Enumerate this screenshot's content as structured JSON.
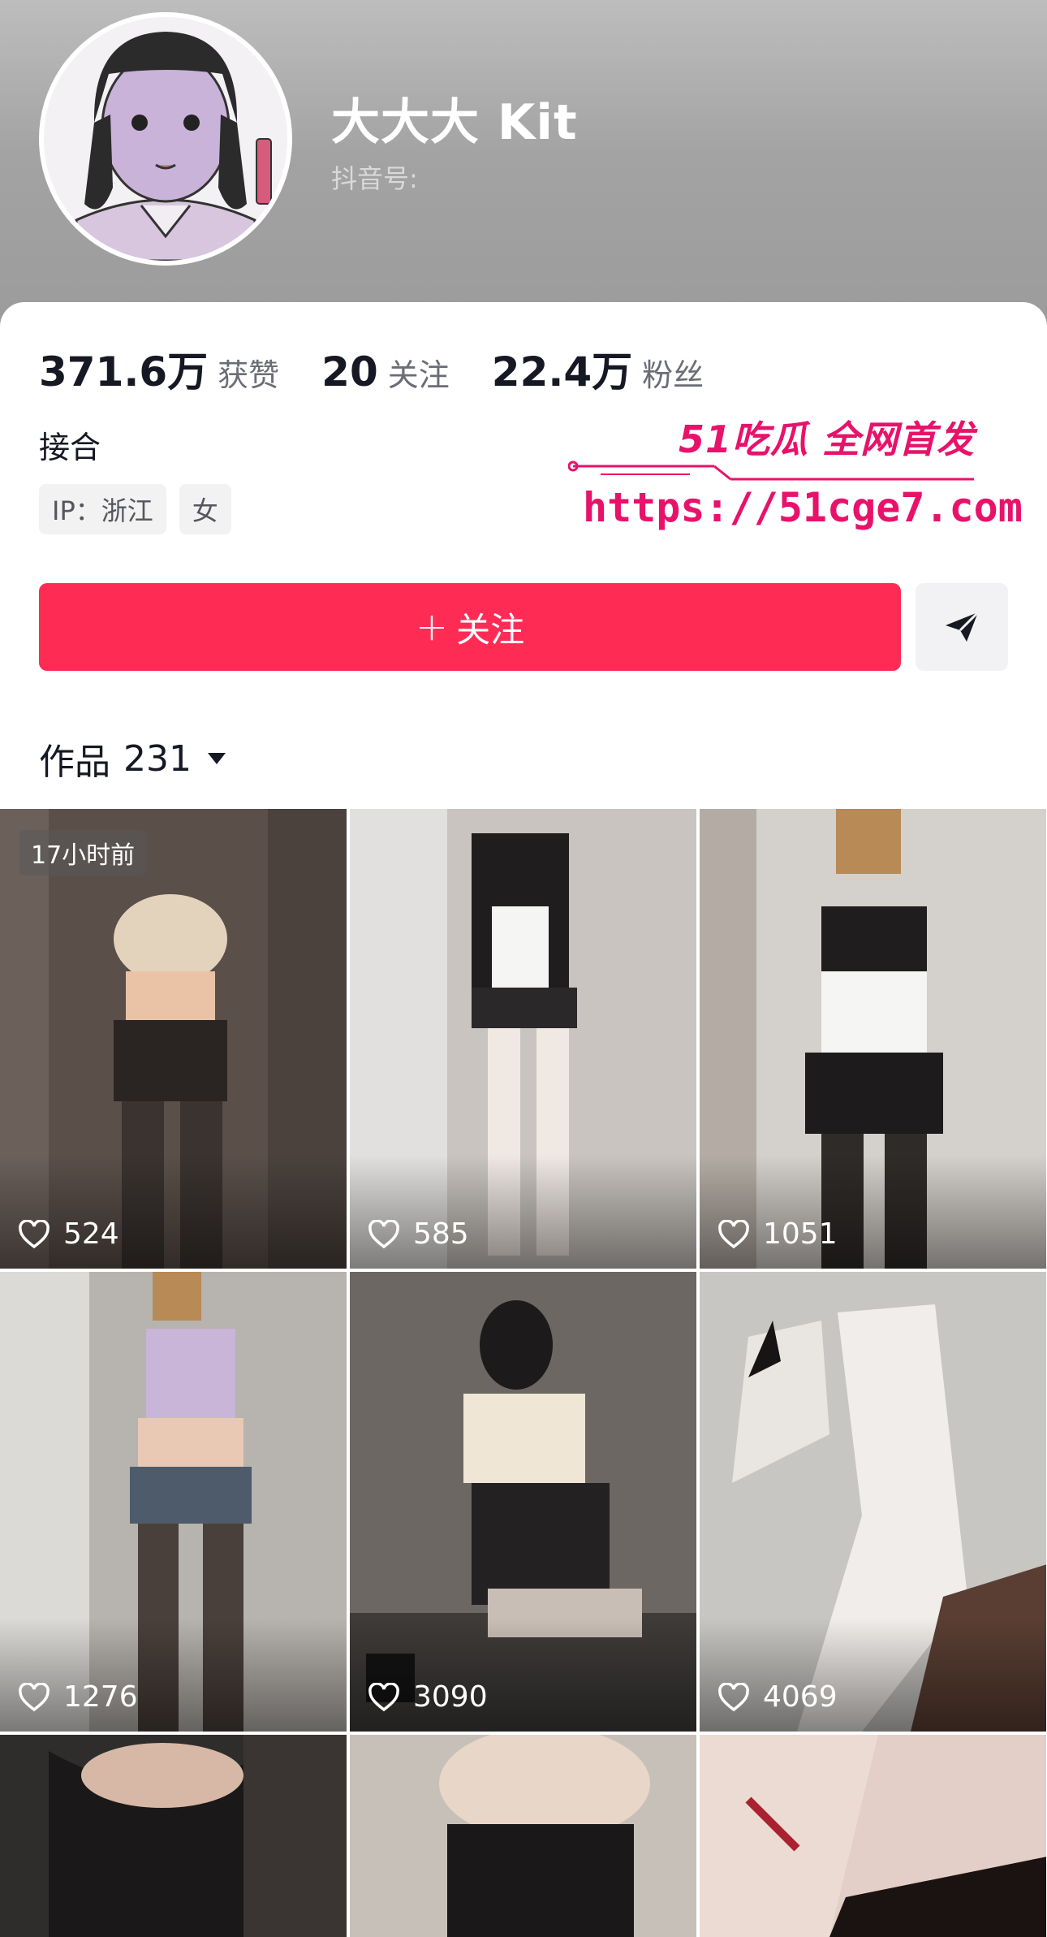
{
  "profile": {
    "nickname": "大大大 Kit",
    "douyin_id_label": "抖音号:",
    "bio": "接合",
    "tags": [
      "IP：浙江",
      "女"
    ]
  },
  "stats": [
    {
      "value": "371.6万",
      "label": "获赞"
    },
    {
      "value": "20",
      "label": "关注"
    },
    {
      "value": "22.4万",
      "label": "粉丝"
    }
  ],
  "watermark": {
    "brand": "51吃瓜 全网首发",
    "url": "https://51cge7.com"
  },
  "actions": {
    "follow_plus": "+",
    "follow_label": "关注",
    "share_icon": "send-icon"
  },
  "works": {
    "label": "作品",
    "count": "231"
  },
  "videos": [
    {
      "likes": "524",
      "badge": "17小时前",
      "bg": "#5a4f49"
    },
    {
      "likes": "585",
      "badge": "",
      "bg": "#c9c4bf"
    },
    {
      "likes": "1051",
      "badge": "",
      "bg": "#d4d0cb"
    },
    {
      "likes": "1276",
      "badge": "",
      "bg": "#b7b3ae"
    },
    {
      "likes": "3090",
      "badge": "",
      "bg": "#6c6763"
    },
    {
      "likes": "4069",
      "badge": "",
      "bg": "#c8c6c3"
    },
    {
      "likes": "",
      "badge": "",
      "bg": "#2f2d2c"
    },
    {
      "likes": "",
      "badge": "",
      "bg": "#c7c0b9"
    },
    {
      "likes": "",
      "badge": "",
      "bg": "#e3cfc7"
    }
  ],
  "colors": {
    "accent": "#fe2c55",
    "watermark": "#e8126b"
  }
}
